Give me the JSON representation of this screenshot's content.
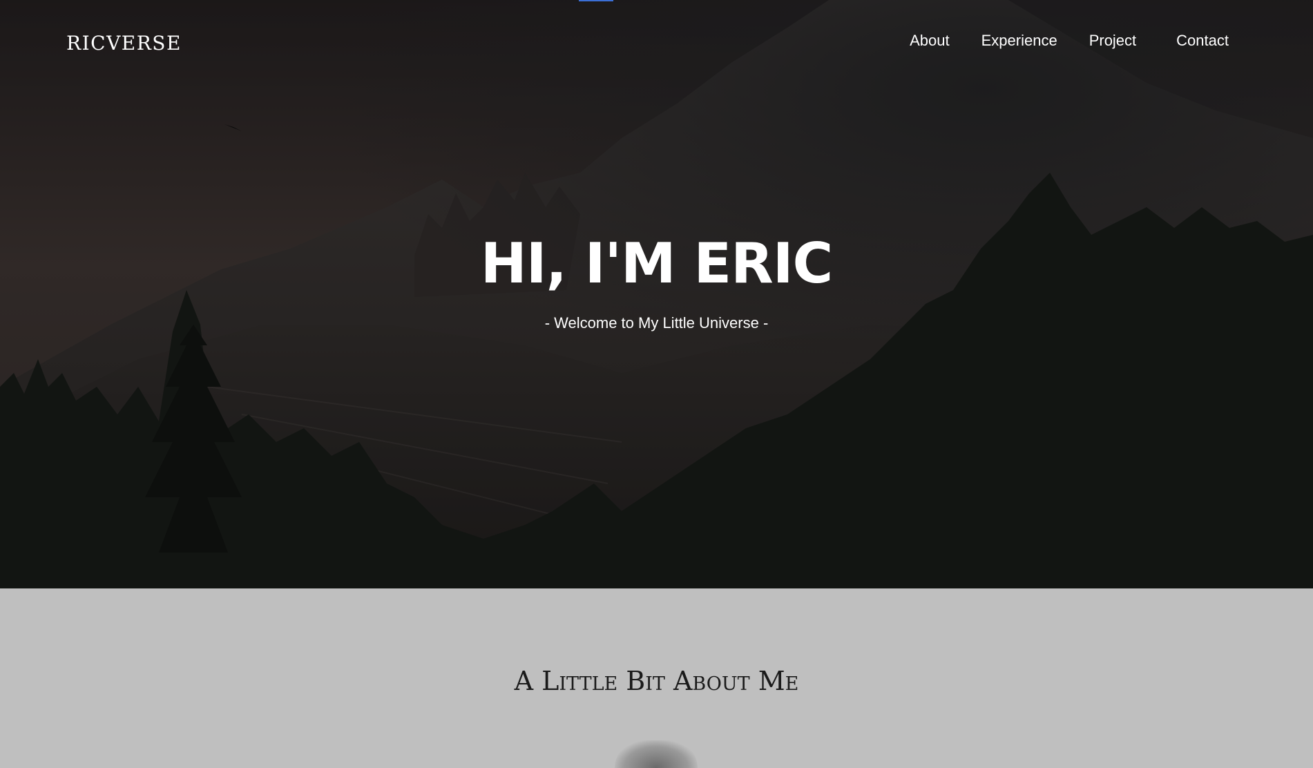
{
  "brand": {
    "name": "RICVERSE"
  },
  "nav": {
    "items": [
      {
        "label": "About"
      },
      {
        "label": "Experience"
      },
      {
        "label": "Project"
      },
      {
        "label": "Contact"
      }
    ]
  },
  "hero": {
    "title": "HI, I'M ERIC",
    "subtitle": "- Welcome to My Little Universe -"
  },
  "about": {
    "heading": "A Little Bit About Me"
  },
  "colors": {
    "hero_overlay": "#1e1d1f",
    "section_bg": "#bfbfbf",
    "text_light": "#ffffff",
    "text_dark": "#1a1a1a",
    "accent": "#3b6fd6"
  }
}
